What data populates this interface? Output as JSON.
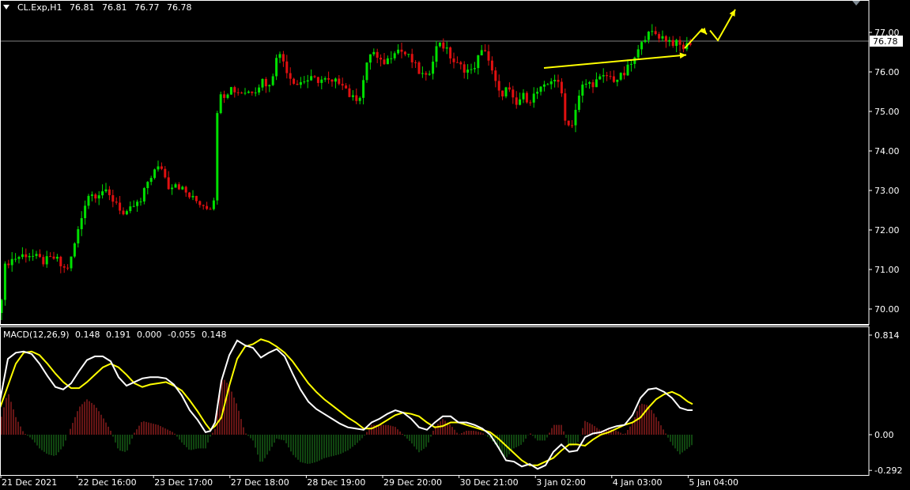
{
  "header": {
    "symbol": "CL.Exp,H1",
    "ohlc": [
      "76.81",
      "76.81",
      "76.77",
      "76.78"
    ]
  },
  "colors": {
    "background": "#000000",
    "grid_frame": "#ffffff",
    "bull_candle": "#00e000",
    "bear_candle": "#e01010",
    "macd_line": "#ffffff",
    "signal_line": "#ffff00",
    "hist_pos": "#cc2a2a",
    "hist_neg": "#1f8a1f",
    "arrows": "#ffff00",
    "price_line": "#808080"
  },
  "icons": [
    "dropdown-triangle-icon"
  ],
  "macd_header": {
    "name": "MACD(12,26,9)",
    "values": [
      "0.148",
      "0.191",
      "0.000",
      "-0.055",
      "0.148"
    ]
  },
  "chart_data": [
    {
      "type": "candlestick",
      "title": "CL.Exp,H1",
      "price_axis_ticks": [
        "77.00",
        "76.00",
        "75.00",
        "74.00",
        "73.00",
        "72.00",
        "71.00",
        "70.00"
      ],
      "ylim": [
        69.6,
        77.8
      ],
      "current_price_label": "76.78",
      "current_price": 76.78,
      "time_axis_labels": [
        "21 Dec 2021",
        "22 Dec 16:00",
        "23 Dec 17:00",
        "27 Dec 18:00",
        "28 Dec 19:00",
        "29 Dec 20:00",
        "30 Dec 21:00",
        "3 Jan 02:00",
        "4 Jan 03:00",
        "5 Jan 04:00"
      ],
      "close_path": [
        [
          0,
          69.9
        ],
        [
          5,
          71.0
        ],
        [
          10,
          71.2
        ],
        [
          20,
          71.3
        ],
        [
          35,
          71.4
        ],
        [
          45,
          71.3
        ],
        [
          55,
          71.2
        ],
        [
          70,
          71.3
        ],
        [
          80,
          71.0
        ],
        [
          88,
          71.1
        ],
        [
          95,
          71.7
        ],
        [
          103,
          72.3
        ],
        [
          110,
          72.9
        ],
        [
          120,
          72.9
        ],
        [
          130,
          73.0
        ],
        [
          140,
          72.8
        ],
        [
          148,
          72.7
        ],
        [
          158,
          72.3
        ],
        [
          168,
          72.6
        ],
        [
          178,
          72.7
        ],
        [
          188,
          73.3
        ],
        [
          196,
          73.5
        ],
        [
          205,
          73.6
        ],
        [
          212,
          73.1
        ],
        [
          222,
          73.2
        ],
        [
          232,
          73.0
        ],
        [
          242,
          72.8
        ],
        [
          252,
          72.7
        ],
        [
          262,
          72.6
        ],
        [
          268,
          72.6
        ],
        [
          272,
          73.0
        ],
        [
          276,
          75.7
        ],
        [
          282,
          75.4
        ],
        [
          292,
          75.6
        ],
        [
          300,
          75.5
        ],
        [
          315,
          75.5
        ],
        [
          325,
          75.6
        ],
        [
          332,
          75.8
        ],
        [
          342,
          75.6
        ],
        [
          350,
          76.5
        ],
        [
          358,
          76.3
        ],
        [
          366,
          75.9
        ],
        [
          376,
          75.7
        ],
        [
          386,
          75.8
        ],
        [
          398,
          75.8
        ],
        [
          410,
          75.8
        ],
        [
          420,
          75.7
        ],
        [
          432,
          75.8
        ],
        [
          445,
          75.3
        ],
        [
          455,
          75.4
        ],
        [
          462,
          76.0
        ],
        [
          470,
          76.6
        ],
        [
          480,
          76.2
        ],
        [
          490,
          76.3
        ],
        [
          500,
          76.6
        ],
        [
          510,
          76.5
        ],
        [
          520,
          76.3
        ],
        [
          530,
          76.0
        ],
        [
          540,
          75.8
        ],
        [
          548,
          76.4
        ],
        [
          556,
          76.8
        ],
        [
          566,
          76.5
        ],
        [
          576,
          76.2
        ],
        [
          586,
          76.1
        ],
        [
          596,
          76.0
        ],
        [
          606,
          76.4
        ],
        [
          614,
          76.6
        ],
        [
          622,
          76.0
        ],
        [
          632,
          75.4
        ],
        [
          642,
          75.6
        ],
        [
          652,
          75.1
        ],
        [
          660,
          75.4
        ],
        [
          670,
          75.3
        ],
        [
          680,
          75.5
        ],
        [
          690,
          75.6
        ],
        [
          700,
          75.9
        ],
        [
          710,
          75.5
        ],
        [
          716,
          74.7
        ],
        [
          722,
          74.6
        ],
        [
          730,
          75.2
        ],
        [
          738,
          75.7
        ],
        [
          748,
          75.7
        ],
        [
          758,
          75.8
        ],
        [
          768,
          75.9
        ],
        [
          778,
          75.8
        ],
        [
          788,
          75.9
        ],
        [
          798,
          76.2
        ],
        [
          806,
          76.4
        ],
        [
          812,
          76.9
        ],
        [
          818,
          76.9
        ],
        [
          826,
          77.0
        ],
        [
          836,
          76.9
        ],
        [
          846,
          76.8
        ],
        [
          856,
          76.7
        ],
        [
          866,
          76.6
        ],
        [
          874,
          76.78
        ]
      ],
      "annotations": [
        {
          "type": "arrow",
          "from": [
            688,
            76.1
          ],
          "to": [
            868,
            76.43
          ]
        },
        {
          "type": "zigzag-arrow",
          "points": [
            [
              866,
              76.6
            ],
            [
              888,
              77.08
            ],
            [
              894,
              76.95
            ]
          ]
        },
        {
          "type": "zigzag-arrow",
          "points": [
            [
              898,
              77.05
            ],
            [
              908,
              76.8
            ],
            [
              930,
              77.58
            ]
          ]
        }
      ]
    },
    {
      "type": "macd",
      "title": "MACD(12,26,9)",
      "y_axis_ticks": [
        "0.814",
        "0.00",
        "-0.292"
      ],
      "ylim": [
        -0.292,
        0.814
      ],
      "macd_line": [
        [
          0,
          0.28
        ],
        [
          10,
          0.62
        ],
        [
          20,
          0.67
        ],
        [
          30,
          0.68
        ],
        [
          40,
          0.66
        ],
        [
          50,
          0.58
        ],
        [
          60,
          0.48
        ],
        [
          70,
          0.39
        ],
        [
          80,
          0.37
        ],
        [
          90,
          0.42
        ],
        [
          100,
          0.52
        ],
        [
          110,
          0.61
        ],
        [
          120,
          0.64
        ],
        [
          130,
          0.64
        ],
        [
          140,
          0.6
        ],
        [
          150,
          0.47
        ],
        [
          160,
          0.4
        ],
        [
          170,
          0.43
        ],
        [
          180,
          0.46
        ],
        [
          190,
          0.47
        ],
        [
          200,
          0.47
        ],
        [
          210,
          0.46
        ],
        [
          220,
          0.41
        ],
        [
          230,
          0.32
        ],
        [
          240,
          0.2
        ],
        [
          250,
          0.12
        ],
        [
          260,
          0.02
        ],
        [
          266,
          0.03
        ],
        [
          272,
          0.1
        ],
        [
          280,
          0.44
        ],
        [
          290,
          0.65
        ],
        [
          300,
          0.77
        ],
        [
          310,
          0.73
        ],
        [
          320,
          0.71
        ],
        [
          330,
          0.63
        ],
        [
          340,
          0.67
        ],
        [
          350,
          0.7
        ],
        [
          360,
          0.64
        ],
        [
          370,
          0.5
        ],
        [
          380,
          0.37
        ],
        [
          390,
          0.27
        ],
        [
          400,
          0.21
        ],
        [
          410,
          0.17
        ],
        [
          420,
          0.13
        ],
        [
          430,
          0.09
        ],
        [
          440,
          0.06
        ],
        [
          450,
          0.05
        ],
        [
          460,
          0.04
        ],
        [
          470,
          0.1
        ],
        [
          480,
          0.13
        ],
        [
          490,
          0.17
        ],
        [
          500,
          0.2
        ],
        [
          510,
          0.18
        ],
        [
          520,
          0.13
        ],
        [
          530,
          0.06
        ],
        [
          540,
          0.04
        ],
        [
          550,
          0.1
        ],
        [
          560,
          0.15
        ],
        [
          570,
          0.15
        ],
        [
          580,
          0.1
        ],
        [
          590,
          0.1
        ],
        [
          600,
          0.08
        ],
        [
          610,
          0.05
        ],
        [
          620,
          0.0
        ],
        [
          630,
          -0.1
        ],
        [
          640,
          -0.21
        ],
        [
          650,
          -0.22
        ],
        [
          660,
          -0.26
        ],
        [
          670,
          -0.24
        ],
        [
          680,
          -0.28
        ],
        [
          690,
          -0.25
        ],
        [
          700,
          -0.14
        ],
        [
          710,
          -0.08
        ],
        [
          720,
          -0.14
        ],
        [
          730,
          -0.13
        ],
        [
          740,
          -0.02
        ],
        [
          750,
          0.01
        ],
        [
          760,
          0.02
        ],
        [
          770,
          0.05
        ],
        [
          780,
          0.07
        ],
        [
          790,
          0.08
        ],
        [
          800,
          0.16
        ],
        [
          810,
          0.3
        ],
        [
          820,
          0.37
        ],
        [
          830,
          0.38
        ],
        [
          840,
          0.35
        ],
        [
          850,
          0.3
        ],
        [
          860,
          0.22
        ],
        [
          870,
          0.2
        ],
        [
          876,
          0.2
        ]
      ],
      "signal_line": [
        [
          0,
          0.22
        ],
        [
          10,
          0.4
        ],
        [
          20,
          0.58
        ],
        [
          30,
          0.67
        ],
        [
          40,
          0.68
        ],
        [
          50,
          0.65
        ],
        [
          60,
          0.58
        ],
        [
          70,
          0.5
        ],
        [
          80,
          0.43
        ],
        [
          90,
          0.38
        ],
        [
          100,
          0.38
        ],
        [
          110,
          0.43
        ],
        [
          120,
          0.49
        ],
        [
          130,
          0.55
        ],
        [
          140,
          0.58
        ],
        [
          150,
          0.55
        ],
        [
          160,
          0.49
        ],
        [
          170,
          0.42
        ],
        [
          180,
          0.39
        ],
        [
          190,
          0.41
        ],
        [
          200,
          0.42
        ],
        [
          210,
          0.43
        ],
        [
          220,
          0.4
        ],
        [
          230,
          0.36
        ],
        [
          240,
          0.28
        ],
        [
          250,
          0.19
        ],
        [
          260,
          0.09
        ],
        [
          266,
          0.04
        ],
        [
          272,
          0.07
        ],
        [
          280,
          0.14
        ],
        [
          290,
          0.4
        ],
        [
          300,
          0.62
        ],
        [
          310,
          0.72
        ],
        [
          320,
          0.74
        ],
        [
          330,
          0.78
        ],
        [
          340,
          0.76
        ],
        [
          350,
          0.72
        ],
        [
          360,
          0.67
        ],
        [
          370,
          0.6
        ],
        [
          380,
          0.51
        ],
        [
          390,
          0.42
        ],
        [
          400,
          0.35
        ],
        [
          410,
          0.29
        ],
        [
          420,
          0.24
        ],
        [
          430,
          0.19
        ],
        [
          440,
          0.14
        ],
        [
          450,
          0.1
        ],
        [
          460,
          0.05
        ],
        [
          470,
          0.05
        ],
        [
          480,
          0.08
        ],
        [
          490,
          0.12
        ],
        [
          500,
          0.16
        ],
        [
          510,
          0.18
        ],
        [
          520,
          0.17
        ],
        [
          530,
          0.15
        ],
        [
          540,
          0.1
        ],
        [
          550,
          0.06
        ],
        [
          560,
          0.07
        ],
        [
          570,
          0.1
        ],
        [
          580,
          0.1
        ],
        [
          590,
          0.08
        ],
        [
          600,
          0.06
        ],
        [
          610,
          0.04
        ],
        [
          620,
          0.02
        ],
        [
          630,
          -0.03
        ],
        [
          640,
          -0.09
        ],
        [
          650,
          -0.15
        ],
        [
          660,
          -0.21
        ],
        [
          670,
          -0.25
        ],
        [
          680,
          -0.25
        ],
        [
          690,
          -0.22
        ],
        [
          700,
          -0.19
        ],
        [
          710,
          -0.13
        ],
        [
          720,
          -0.08
        ],
        [
          730,
          -0.08
        ],
        [
          740,
          -0.09
        ],
        [
          750,
          -0.04
        ],
        [
          760,
          0.0
        ],
        [
          770,
          0.02
        ],
        [
          780,
          0.05
        ],
        [
          790,
          0.08
        ],
        [
          800,
          0.1
        ],
        [
          810,
          0.14
        ],
        [
          820,
          0.22
        ],
        [
          830,
          0.29
        ],
        [
          840,
          0.33
        ],
        [
          850,
          0.35
        ],
        [
          860,
          0.32
        ],
        [
          870,
          0.27
        ],
        [
          876,
          0.25
        ]
      ],
      "histogram_note": "difference between macd_line and signal_line"
    }
  ]
}
